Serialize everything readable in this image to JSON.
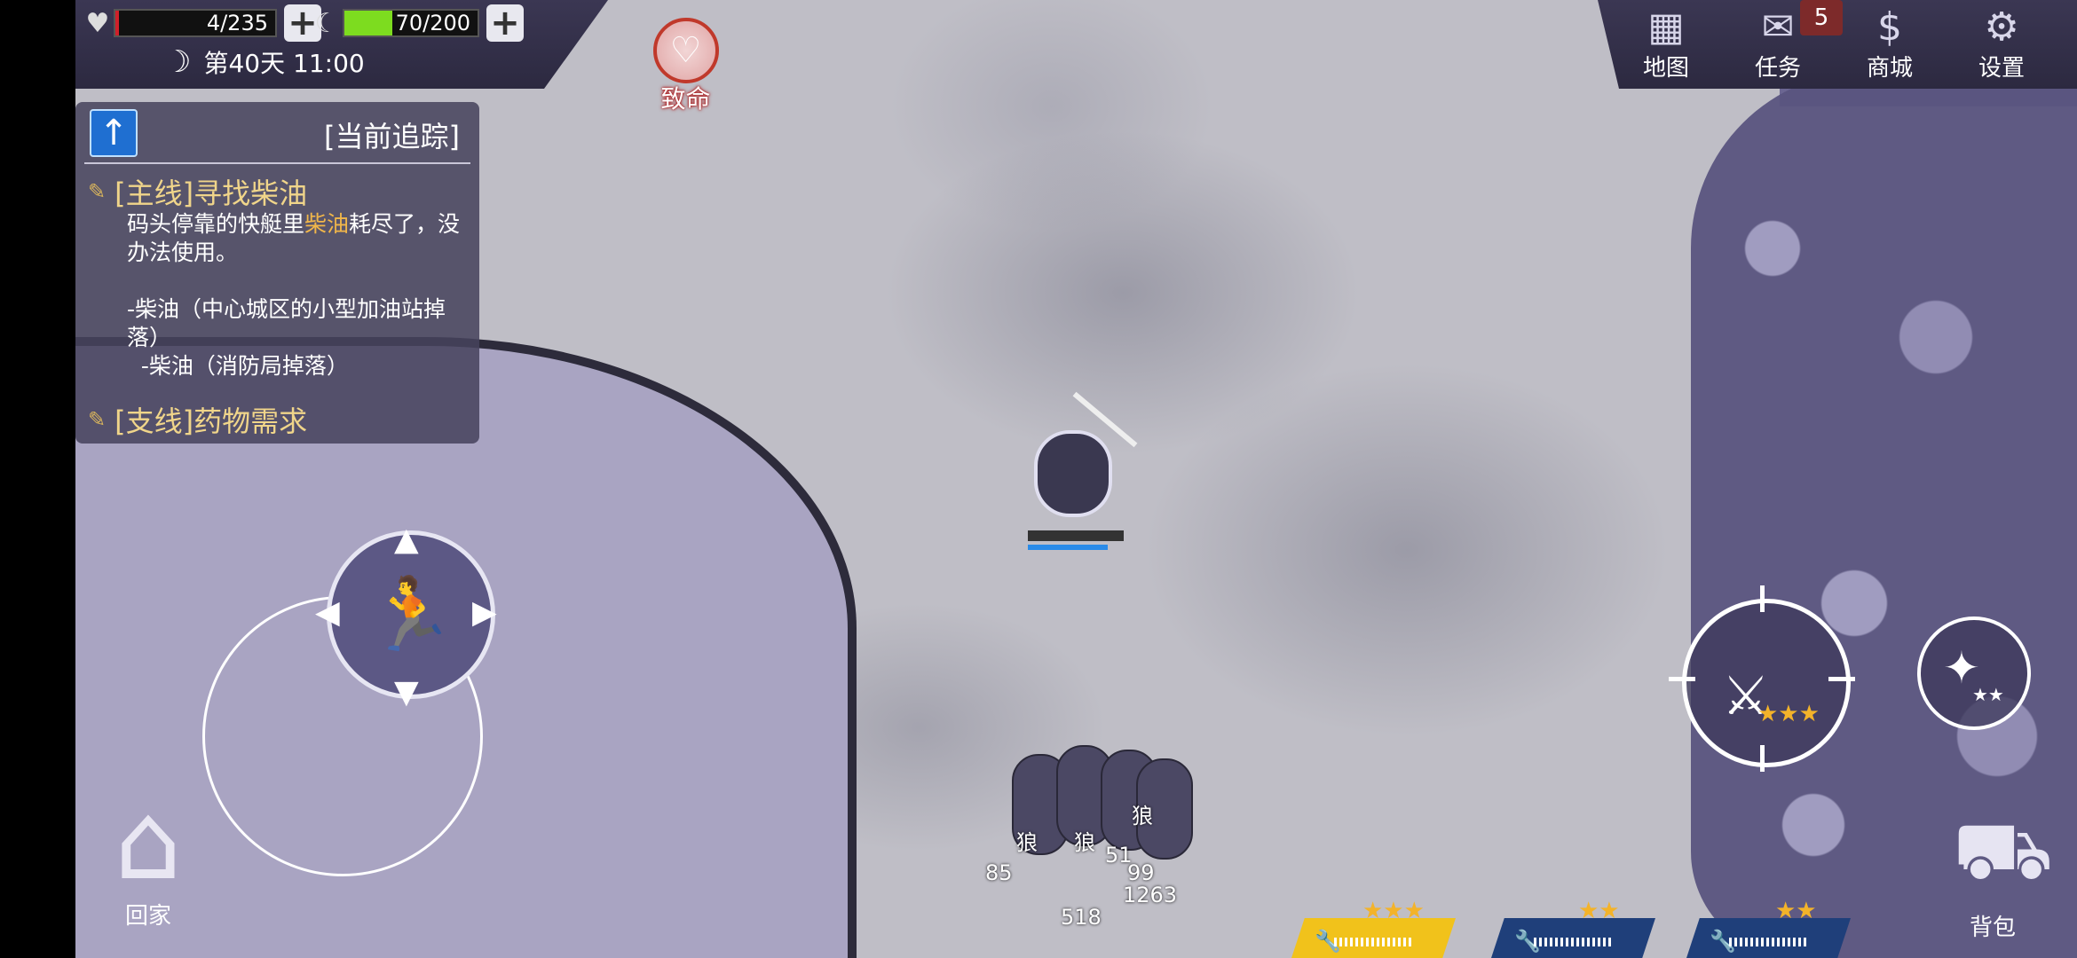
{
  "hud": {
    "health": {
      "value": 4,
      "max": 235,
      "text": "4/235"
    },
    "hunger": {
      "value": 70,
      "max": 200,
      "text": "70/200"
    },
    "time": "第40天 11:00",
    "danger_label": "致命"
  },
  "menu": [
    {
      "label": "地图",
      "icon": "map-icon"
    },
    {
      "label": "任务",
      "icon": "task-icon",
      "badge": "5"
    },
    {
      "label": "商城",
      "icon": "shop-icon"
    },
    {
      "label": "设置",
      "icon": "gear-icon"
    }
  ],
  "quest": {
    "header": "[当前追踪]",
    "main_title": "[主线]寻找柴油",
    "desc_before": "码头停靠的快艇里",
    "desc_highlight": "柴油",
    "desc_after": "耗尽了，没办法使用。",
    "item1": "-柴油（中心城区的小型加油站掉落）",
    "item2": "-柴油（消防局掉落）",
    "side_title": "[支线]药物需求"
  },
  "home_label": "回家",
  "bag_label": "背包",
  "enemy_label": "狼",
  "enemy_numbers": [
    "85",
    "51",
    "1263",
    "518",
    "99"
  ],
  "weapons": [
    {
      "stars": "★★★",
      "selected": true
    },
    {
      "stars": "★★",
      "selected": false
    },
    {
      "stars": "★★",
      "selected": false
    }
  ],
  "attack_stars": "★★★",
  "alt_stars": "★★",
  "colors": {
    "health": "#d0202a",
    "hunger": "#7ddc1f",
    "accent": "#f3b32a"
  }
}
